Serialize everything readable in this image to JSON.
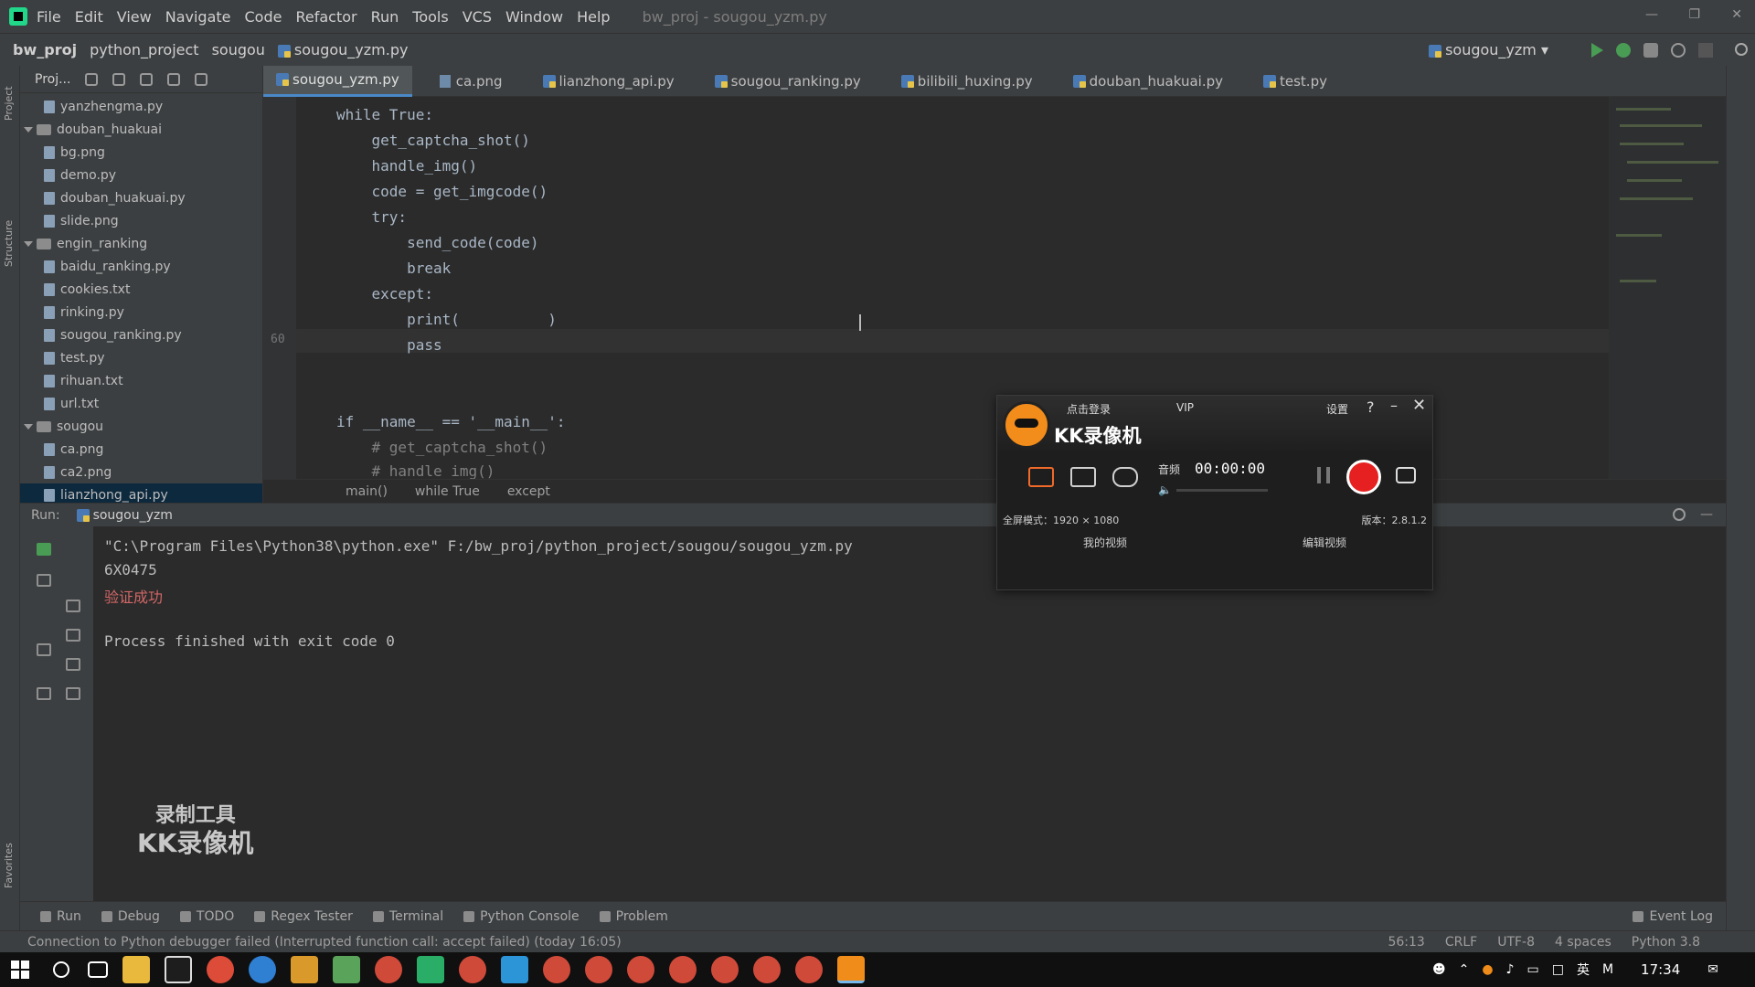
{
  "menubar": {
    "items": [
      "File",
      "Edit",
      "View",
      "Navigate",
      "Code",
      "Refactor",
      "Run",
      "Tools",
      "VCS",
      "Window",
      "Help"
    ],
    "title": "bw_proj - sougou_yzm.py"
  },
  "navbar": {
    "crumbs": [
      "bw_proj",
      "python_project",
      "sougou",
      "sougou_yzm.py"
    ],
    "run_config": "sougou_yzm"
  },
  "project_panel": {
    "header": "Proj...",
    "tree": [
      {
        "label": "yanzhengma.py",
        "kind": "file",
        "indent": 1
      },
      {
        "label": "douban_huakuai",
        "kind": "folder",
        "indent": 0
      },
      {
        "label": "bg.png",
        "kind": "file",
        "indent": 1
      },
      {
        "label": "demo.py",
        "kind": "file",
        "indent": 1
      },
      {
        "label": "douban_huakuai.py",
        "kind": "file",
        "indent": 1
      },
      {
        "label": "slide.png",
        "kind": "file",
        "indent": 1
      },
      {
        "label": "engin_ranking",
        "kind": "folder",
        "indent": 0
      },
      {
        "label": "baidu_ranking.py",
        "kind": "file",
        "indent": 1
      },
      {
        "label": "cookies.txt",
        "kind": "file",
        "indent": 1
      },
      {
        "label": "rinking.py",
        "kind": "file",
        "indent": 1
      },
      {
        "label": "sougou_ranking.py",
        "kind": "file",
        "indent": 1
      },
      {
        "label": "test.py",
        "kind": "file",
        "indent": 1
      },
      {
        "label": "rihuan.txt",
        "kind": "file",
        "indent": 1
      },
      {
        "label": "url.txt",
        "kind": "file",
        "indent": 1
      },
      {
        "label": "sougou",
        "kind": "folder",
        "indent": 0
      },
      {
        "label": "ca.png",
        "kind": "file",
        "indent": 1
      },
      {
        "label": "ca2.png",
        "kind": "file",
        "indent": 1
      },
      {
        "label": "lianzhong_api.py",
        "kind": "file",
        "indent": 1,
        "selected": true
      }
    ]
  },
  "editor_tabs": [
    {
      "label": "sougou_yzm.py",
      "active": true,
      "icon": "python-file-icon"
    },
    {
      "label": "ca.png",
      "icon": "image-file-icon"
    },
    {
      "label": "lianzhong_api.py",
      "icon": "python-file-icon"
    },
    {
      "label": "sougou_ranking.py",
      "icon": "python-file-icon"
    },
    {
      "label": "bilibili_huxing.py",
      "icon": "python-file-icon"
    },
    {
      "label": "douban_huakuai.py",
      "icon": "python-file-icon"
    },
    {
      "label": "test.py",
      "icon": "python-file-icon"
    }
  ],
  "code": {
    "lines": [
      "while True:",
      "    get_captcha_shot()",
      "    handle_img()",
      "    code = get_imgcode()",
      "    try:",
      "        send_code(code)",
      "        break",
      "    except:",
      "        print(          )",
      "        pass",
      "",
      "",
      "if __name__ == '__main__':",
      "    # get_captcha_shot()",
      "    # handle_img()"
    ],
    "gutter_mark": "60"
  },
  "code_breadcrumb": [
    "main()",
    "while True",
    "except"
  ],
  "run_panel": {
    "label": "Run:",
    "config": "sougou_yzm",
    "console": [
      "\"C:\\Program Files\\Python38\\python.exe\" F:/bw_proj/python_project/sougou/sougou_yzm.py",
      "6X0475",
      "验证成功",
      "",
      "Process finished with exit code 0"
    ]
  },
  "watermark": {
    "line1": "录制工具",
    "line2": "KK录像机"
  },
  "bottom_tabs": [
    "Run",
    "Debug",
    "TODO",
    "Regex Tester",
    "Terminal",
    "Python Console",
    "Problem"
  ],
  "bottom_event_log": "Event Log",
  "statusbar": {
    "message": "Connection to Python debugger failed (Interrupted function call: accept failed) (today 16:05)",
    "right": [
      "56:13",
      "CRLF",
      "UTF-8",
      "4 spaces",
      "Python 3.8"
    ]
  },
  "taskbar": {
    "apps": [
      "start",
      "cortana",
      "task-view",
      "explorer",
      "pycharm",
      "chrome",
      "edge",
      "app1",
      "app2",
      "app3",
      "wechat",
      "app4",
      "app5",
      "app6",
      "app7",
      "app8",
      "app9",
      "app10",
      "app11",
      "app12",
      "kk-recorder"
    ],
    "tray": [
      "英",
      "M"
    ],
    "clock": "17:34"
  },
  "kk_recorder": {
    "title": "KK录像机",
    "login": "点击登录",
    "vip": "VIP",
    "settings": "设置",
    "help": "?",
    "sound_label": "音频",
    "time": "00:00:00",
    "mode_text": "全屏模式：1920 × 1080",
    "version": "版本：2.8.1.2",
    "my_videos": "我的视频",
    "edit_video": "编辑视频",
    "accent": "#e62020"
  },
  "colors": {
    "editor_bg": "#2b2b2b",
    "panel_bg": "#3c3f41",
    "keyword": "#cc7832",
    "string": "#6a8759",
    "error_text": "#d26666"
  }
}
